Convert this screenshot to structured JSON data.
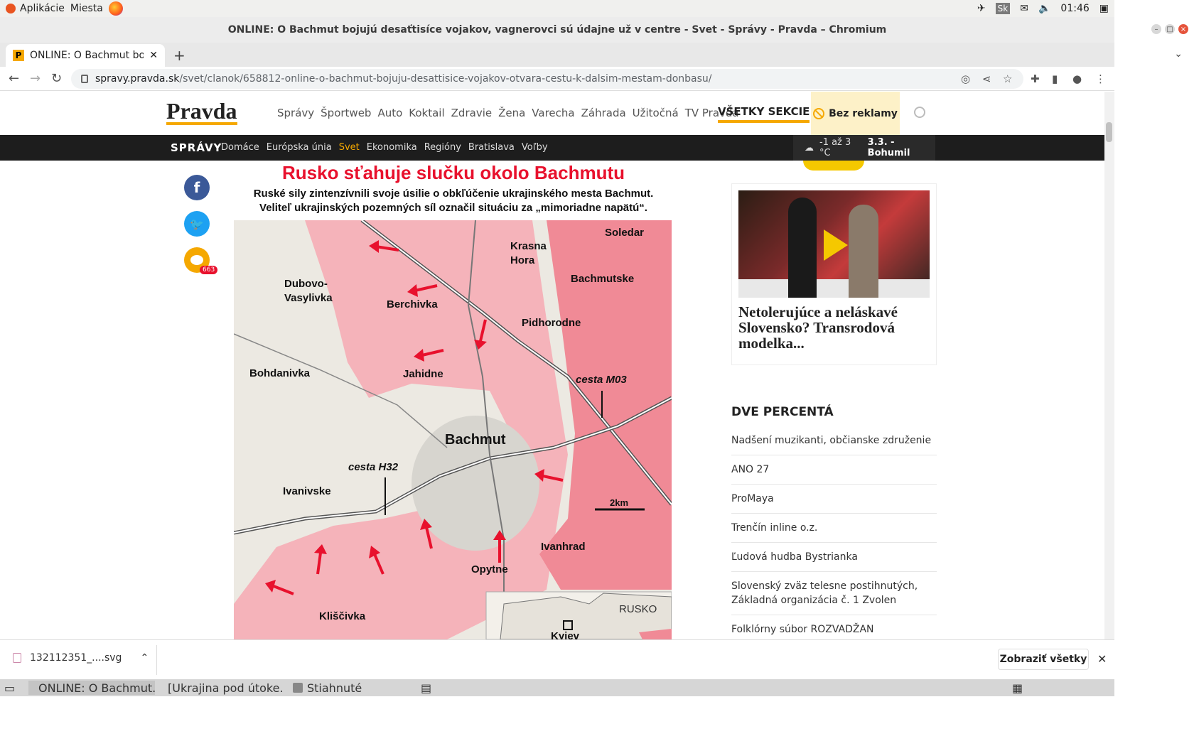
{
  "os": {
    "apps_label": "Aplikácie",
    "places_label": "Miesta",
    "keyboard_layout": "Sk",
    "clock": "01:46"
  },
  "window": {
    "title": "ONLINE: O Bachmut bojujú desaťtisíce vojakov, vagnerovci sú údajne už v centre - Svet - Správy - Pravda – Chromium"
  },
  "tab": {
    "title": "ONLINE: O Bachmut bojujú"
  },
  "omnibox": {
    "host": "spravy.pravda.sk",
    "path": "/svet/clanok/658812-online-o-bachmut-bojuju-desattisice-vojakov-otvara-cestu-k-dalsim-mestam-donbasu/"
  },
  "site": {
    "logo": "Pravda",
    "nav": [
      "Správy",
      "Športweb",
      "Auto",
      "Koktail",
      "Zdravie",
      "Žena",
      "Varecha",
      "Záhrada",
      "Užitočná",
      "TV Pravda"
    ],
    "all_sections": "VŠETKY SEKCIE",
    "no_ads": "Bez reklamy",
    "section_title": "SPRÁVY",
    "subnav": [
      "Domáce",
      "Európska únia",
      "Svet",
      "Ekonomika",
      "Regióny",
      "Bratislava",
      "Voľby"
    ],
    "weather_temp": "-1 až 3 °C",
    "nameday": "3.3. - Bohumil"
  },
  "share": {
    "comments_count": "663"
  },
  "figure": {
    "title": "Rusko sťahuje slučku okolo Bachmutu",
    "subtitle_line1": "Ruské sily zintenzívnili svoje úsilie o obkľúčenie ukrajinského mesta Bachmut.",
    "subtitle_line2": "Veliteľ ukrajinských pozemných síl označil situáciu za „mimoriadne napätú“.",
    "places": {
      "soledar": "Soledar",
      "krasna_1": "Krasna",
      "krasna_2": "Hora",
      "bachmutske": "Bachmutske",
      "dubovo_1": "Dubovo-",
      "dubovo_2": "Vasylivka",
      "berchivka": "Berchivka",
      "pidhorodne": "Pidhorodne",
      "bohdanivka": "Bohdanivka",
      "jahidne": "Jahidne",
      "road_m03": "cesta M03",
      "bachmut": "Bachmut",
      "road_h32": "cesta H32",
      "ivanivske": "Ivanivske",
      "ivanhrad": "Ivanhrad",
      "opytne": "Opytne",
      "kliscivka": "Kliščivka",
      "scale": "2km",
      "inset_rusko": "RUSKO",
      "inset_kyiv": "Kyjev"
    },
    "colors": {
      "russian_control": "#f08a96",
      "russian_advance": "#f5b3ba",
      "arrow": "#e8112d"
    }
  },
  "sidebar": {
    "promo_title": "Netolerujúce a neláskavé Slovensko? Transrodová modelka...",
    "dve_header": "DVE PERCENTÁ",
    "dve_items": [
      "Nadšení muzikanti, občianske združenie",
      "ANO 27",
      "ProMaya",
      "Trenčín inline o.z.",
      "Ľudová hudba Bystrianka",
      "Slovenský zväz telesne postihnutých, Základná organizácia č. 1 Zvolen",
      "Folklórny súbor ROZVADŽAN"
    ]
  },
  "downloads": {
    "file": "132112351_....svg",
    "show_all": "Zobraziť všetky"
  },
  "taskbar": {
    "items": [
      "ONLINE: O Bachmut...",
      "[Ukrajina pod útoke...",
      "Stiahnuté"
    ]
  }
}
